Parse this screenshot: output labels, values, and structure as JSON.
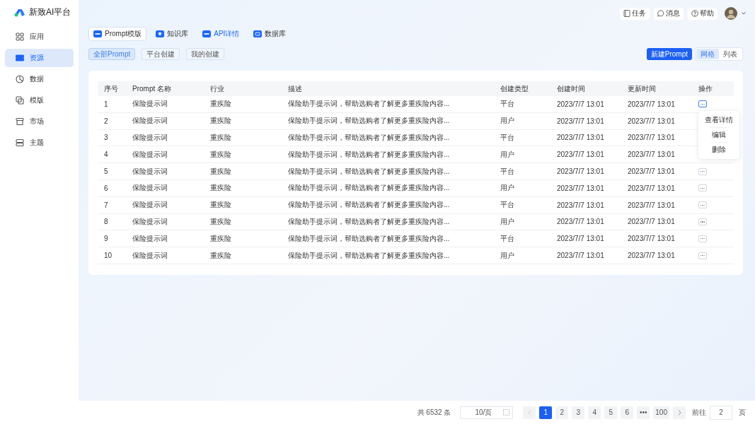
{
  "brand": {
    "name": "新致AI平台"
  },
  "sidebar": {
    "items": [
      {
        "label": "应用",
        "selected": false
      },
      {
        "label": "资源",
        "selected": true
      },
      {
        "label": "数据",
        "selected": false
      },
      {
        "label": "模版",
        "selected": false
      },
      {
        "label": "市场",
        "selected": false
      },
      {
        "label": "主题",
        "selected": false
      }
    ]
  },
  "topbar": {
    "buttons": [
      {
        "label": "任务"
      },
      {
        "label": "消息"
      },
      {
        "label": "帮助"
      }
    ]
  },
  "tabs": [
    {
      "label": "Prompt模版",
      "selected": true,
      "highlighted": false
    },
    {
      "label": "知识库",
      "selected": false,
      "highlighted": false
    },
    {
      "label": "API详情",
      "selected": false,
      "highlighted": true
    },
    {
      "label": "数据库",
      "selected": false,
      "highlighted": false
    }
  ],
  "filters": [
    {
      "label": "全部Prompt",
      "selected": true
    },
    {
      "label": "平台创建",
      "selected": false
    },
    {
      "label": "我的创建",
      "selected": false
    }
  ],
  "new_button": "新建Prompt",
  "view_toggle": [
    {
      "label": "网格",
      "selected": true
    },
    {
      "label": "列表",
      "selected": false
    }
  ],
  "table": {
    "columns": [
      "序号",
      "Prompt 名称",
      "行业",
      "描述",
      "创建类型",
      "创建时间",
      "更新时间",
      "操作"
    ],
    "rows": [
      {
        "cells": [
          "1",
          "保险提示词",
          "重疾险",
          "保险助手提示词，帮助选购者了解更多重疾险内容...",
          "平台",
          "2023/7/7 13:01",
          "2023/7/7 13:01"
        ],
        "menu_open": true
      },
      {
        "cells": [
          "2",
          "保险提示词",
          "重疾险",
          "保险助手提示词，帮助选购者了解更多重疾险内容...",
          "用户",
          "2023/7/7 13:01",
          "2023/7/7 13:01"
        ],
        "menu_open": false
      },
      {
        "cells": [
          "3",
          "保险提示词",
          "重疾险",
          "保险助手提示词，帮助选购者了解更多重疾险内容...",
          "平台",
          "2023/7/7 13:01",
          "2023/7/7 13:01"
        ],
        "menu_open": false
      },
      {
        "cells": [
          "4",
          "保险提示词",
          "重疾险",
          "保险助手提示词，帮助选购者了解更多重疾险内容...",
          "用户",
          "2023/7/7 13:01",
          "2023/7/7 13:01"
        ],
        "menu_open": false
      },
      {
        "cells": [
          "5",
          "保险提示词",
          "重疾险",
          "保险助手提示词，帮助选购者了解更多重疾险内容...",
          "平台",
          "2023/7/7 13:01",
          "2023/7/7 13:01"
        ],
        "menu_open": false
      },
      {
        "cells": [
          "6",
          "保险提示词",
          "重疾险",
          "保险助手提示词，帮助选购者了解更多重疾险内容...",
          "用户",
          "2023/7/7 13:01",
          "2023/7/7 13:01"
        ],
        "menu_open": false
      },
      {
        "cells": [
          "7",
          "保险提示词",
          "重疾险",
          "保险助手提示词，帮助选购者了解更多重疾险内容...",
          "平台",
          "2023/7/7 13:01",
          "2023/7/7 13:01"
        ],
        "menu_open": false
      },
      {
        "cells": [
          "8",
          "保险提示词",
          "重疾险",
          "保险助手提示词，帮助选购者了解更多重疾险内容...",
          "用户",
          "2023/7/7 13:01",
          "2023/7/7 13:01"
        ],
        "menu_open": false
      },
      {
        "cells": [
          "9",
          "保险提示词",
          "重疾险",
          "保险助手提示词，帮助选购者了解更多重疾险内容...",
          "平台",
          "2023/7/7 13:01",
          "2023/7/7 13:01"
        ],
        "menu_open": false
      },
      {
        "cells": [
          "10",
          "保险提示词",
          "重疾险",
          "保险助手提示词，帮助选购者了解更多重疾险内容...",
          "用户",
          "2023/7/7 13:01",
          "2023/7/7 13:01"
        ],
        "menu_open": false
      }
    ]
  },
  "row_menu": [
    "查看详情",
    "编辑",
    "删除"
  ],
  "pagination": {
    "total": "共 6532 条",
    "page_size": "10/页",
    "pages": [
      {
        "label": "1",
        "selected": true
      },
      {
        "label": "2",
        "selected": false
      },
      {
        "label": "3",
        "selected": false
      },
      {
        "label": "4",
        "selected": false
      },
      {
        "label": "5",
        "selected": false
      },
      {
        "label": "6",
        "selected": false
      },
      {
        "label": "•••",
        "selected": false
      },
      {
        "label": "100",
        "selected": false
      }
    ],
    "goto_label": "前往",
    "goto_value": "2",
    "goto_suffix": "页"
  }
}
